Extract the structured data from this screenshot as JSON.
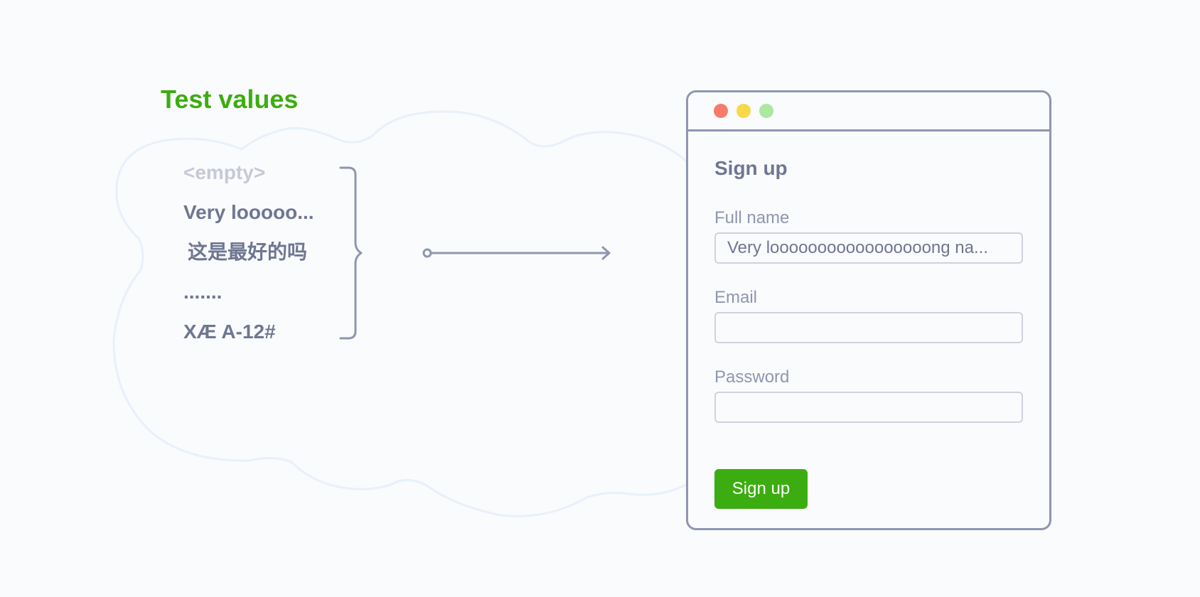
{
  "heading": "Test values",
  "test_values": [
    "<empty>",
    "Very looooo...",
    "这是最好的吗",
    ".......",
    "XÆ A-12#"
  ],
  "window": {
    "traffic_lights": [
      "#f77b6b",
      "#f7d84a",
      "#ade8a0"
    ],
    "form_title": "Sign up",
    "fields": [
      {
        "label": "Full name",
        "value": "Very looooooooooooooooong na..."
      },
      {
        "label": "Email",
        "value": ""
      },
      {
        "label": "Password",
        "value": ""
      }
    ],
    "submit_label": "Sign up"
  },
  "colors": {
    "accent": "#3cad10",
    "text": "#6f7692",
    "muted": "#c6c9d6",
    "outline": "#8f96b0",
    "cloud": "#e8f0fb"
  }
}
